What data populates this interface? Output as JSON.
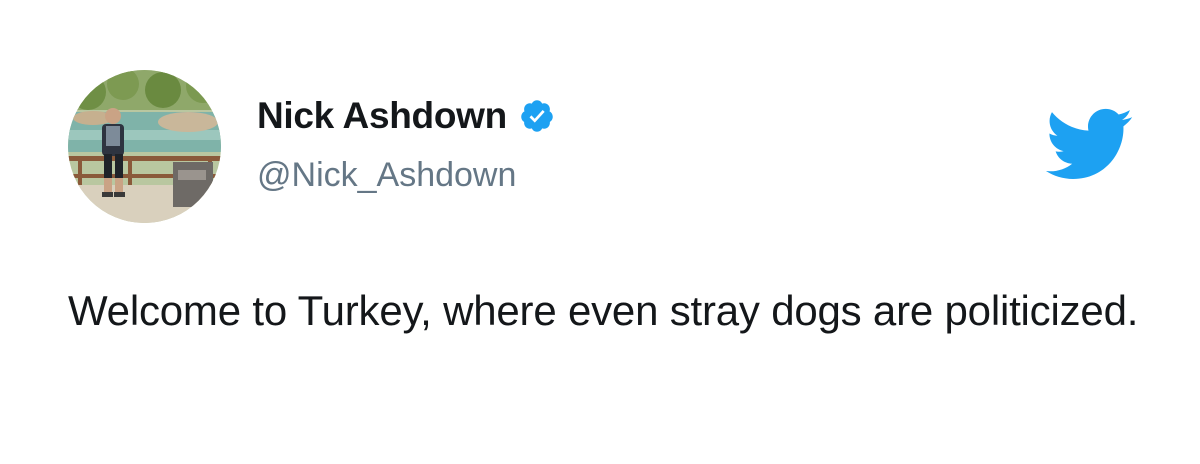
{
  "author": {
    "display_name": "Nick Ashdown",
    "handle": "@Nick_Ashdown",
    "verified": true,
    "avatar_icon": "avatar-photo"
  },
  "tweet": {
    "text": "Welcome to Turkey, where even stray dogs are politicized."
  },
  "brand": {
    "logo_icon": "twitter-bird-icon",
    "brand_color": "#1da1f2"
  },
  "colors": {
    "name_text": "#14171a",
    "handle_text": "#657786",
    "verified_badge": "#1da1f2"
  }
}
